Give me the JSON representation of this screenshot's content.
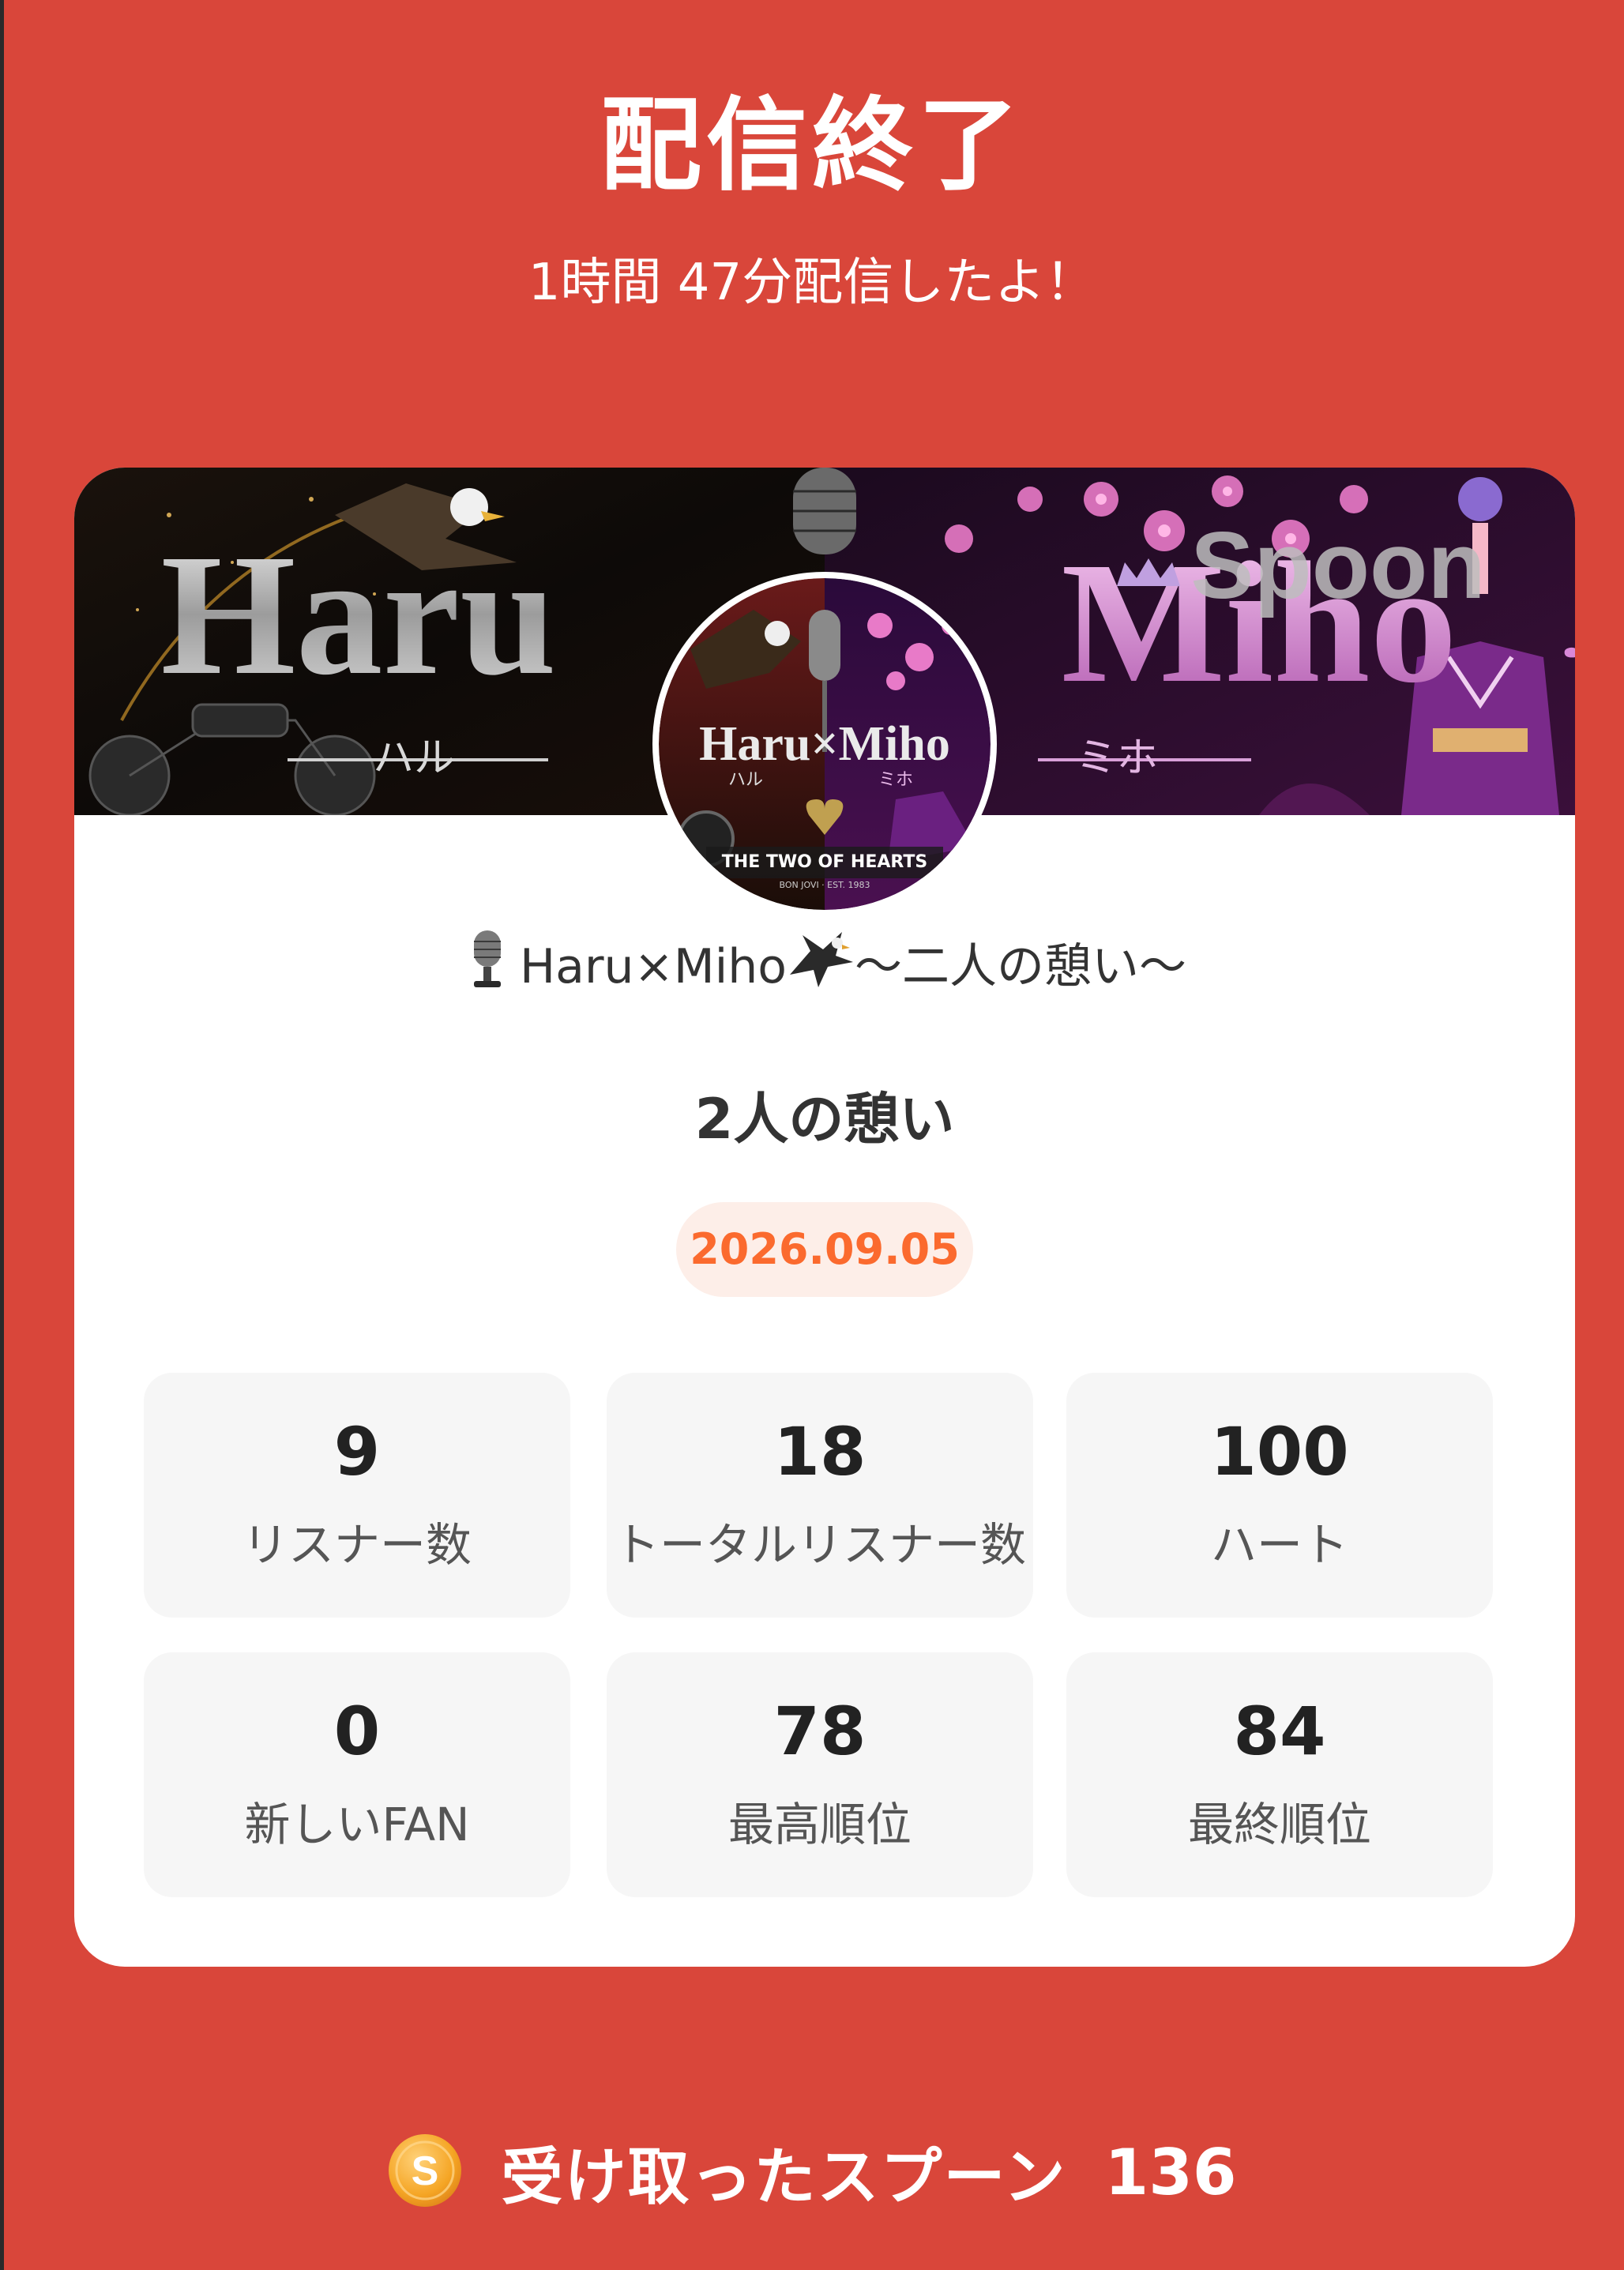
{
  "header": {
    "title": "配信終了",
    "subtitle": "1時間 47分配信したよ！"
  },
  "card": {
    "banner": {
      "left_text": "Haru",
      "right_text": "Miho",
      "left_kana": "ハル",
      "right_kana": "ミホ",
      "brand": "Spoon"
    },
    "avatar": {
      "title": "Haru×Miho",
      "left_kana": "ハル",
      "right_kana": "ミホ",
      "caption": "THE TWO OF HEARTS",
      "caption_small": "BON JOVI · EST. 1983"
    },
    "channel_name": "Haru×Miho",
    "channel_suffix": "～二人の憩い～",
    "live_title": "2人の憩い",
    "date": "2026.09.05",
    "stats": [
      {
        "value": "9",
        "label": "リスナー数"
      },
      {
        "value": "18",
        "label": "トータルリスナー数"
      },
      {
        "value": "100",
        "label": "ハート"
      },
      {
        "value": "0",
        "label": "新しいFAN"
      },
      {
        "value": "78",
        "label": "最高順位"
      },
      {
        "value": "84",
        "label": "最終順位"
      }
    ]
  },
  "spoons": {
    "icon": "spoon-coin-icon",
    "icon_letter": "S",
    "label": "受け取ったスプーン",
    "value": "136"
  },
  "colors": {
    "background": "#d9463a",
    "card": "#ffffff",
    "stat_bg": "#f6f6f6",
    "date_text": "#fb6a2e",
    "date_bg": "#fdeee8",
    "coin": "#f5a524"
  }
}
